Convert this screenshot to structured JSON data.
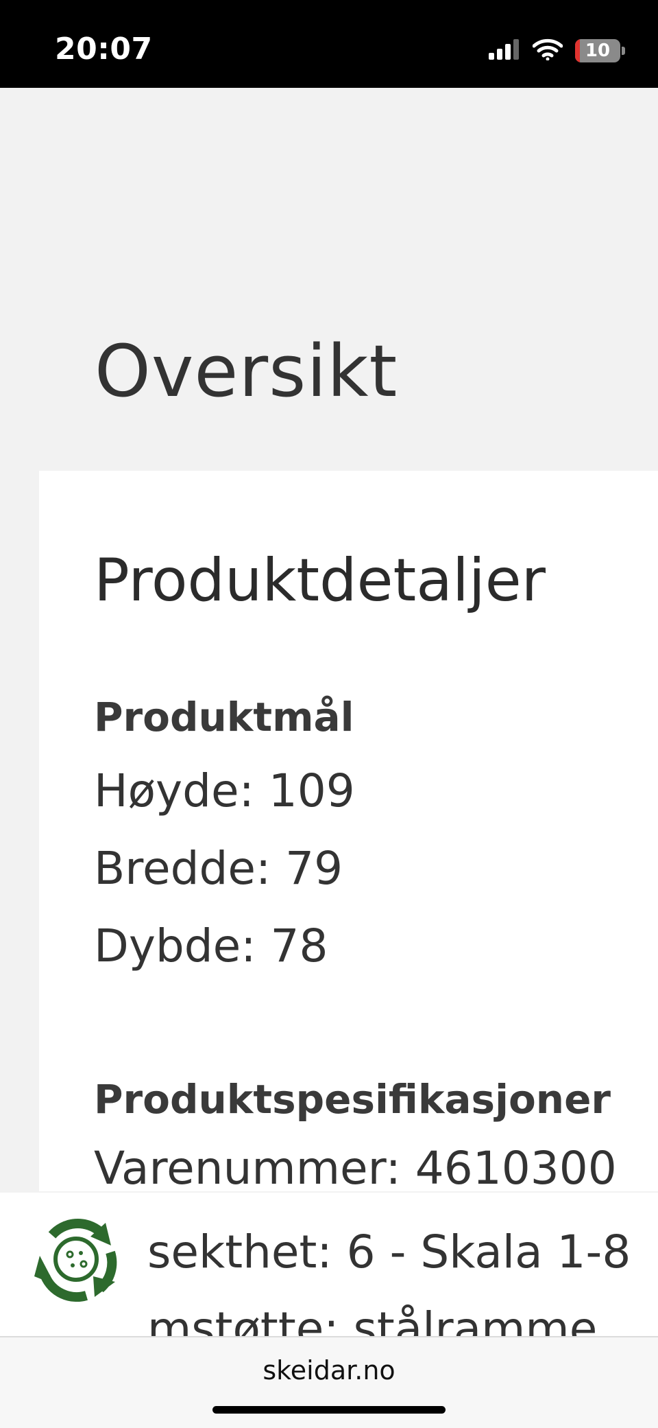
{
  "status_bar": {
    "time": "20:07",
    "battery_level": "10",
    "battery_fraction": 0.1,
    "icons": [
      "signal-icon",
      "wifi-icon",
      "battery-icon"
    ],
    "battery_color": "#e0332f"
  },
  "page": {
    "title": "Oversikt"
  },
  "product_details": {
    "title": "Produktdetaljer",
    "dimensions_heading": "Produktmål",
    "height": "Høyde: 109",
    "width": "Bredde: 79",
    "depth": "Dybde: 78",
    "specs_heading": "Produktspesifikasjoner",
    "item_number": "Varenummer: 4610300",
    "firmness_clipped": "sekthet: 6 - Skala 1-8",
    "support_clipped": "mstøtte: stålramme"
  },
  "eco_badge": {
    "icon": "recycle-icon",
    "color": "#2d6a2d"
  },
  "browser": {
    "domain": "skeidar.no"
  }
}
